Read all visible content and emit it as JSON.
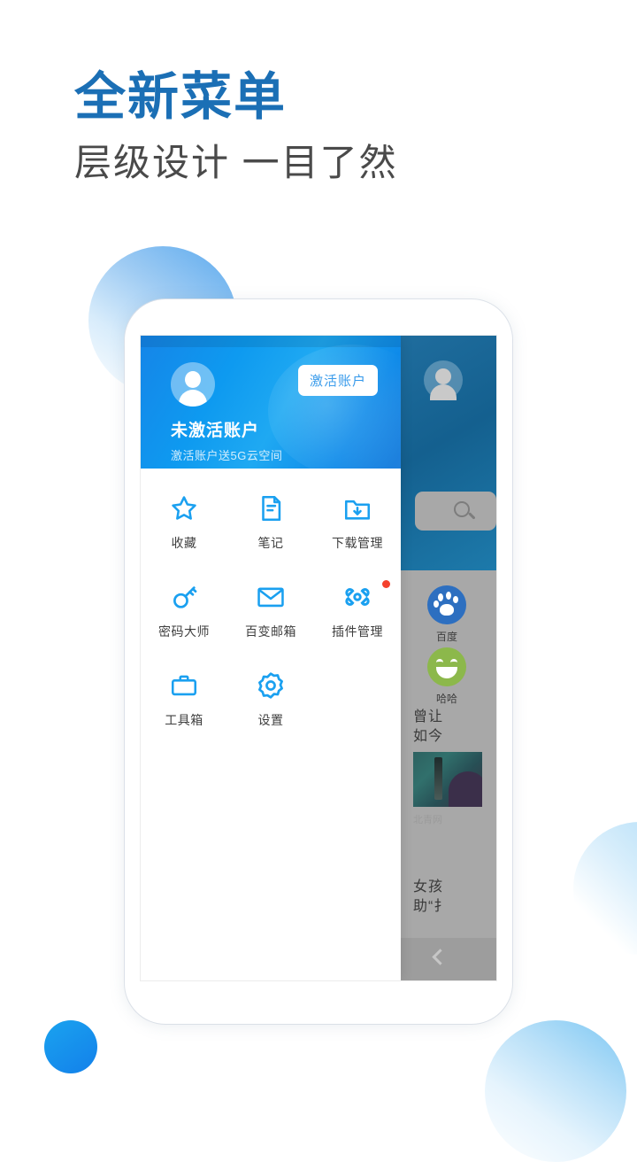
{
  "promo": {
    "headline": "全新菜单",
    "subheadline": "层级设计 一目了然",
    "headline_color": "#1b6fb5",
    "subheadline_color": "#4a4a4a"
  },
  "phone": {
    "menu_panel": {
      "header": {
        "avatar_icon": "user-avatar-icon",
        "activate_button": "激活账户",
        "title": "未激活账户",
        "subtitle": "激活账户送5G云空间",
        "gradient_from": "#1585e8",
        "gradient_to": "#1f7fdc"
      },
      "grid": [
        {
          "label": "收藏",
          "icon": "star-icon",
          "badge": false
        },
        {
          "label": "笔记",
          "icon": "note-icon",
          "badge": false
        },
        {
          "label": "下载管理",
          "icon": "download-folder-icon",
          "badge": false
        },
        {
          "label": "密码大师",
          "icon": "key-icon",
          "badge": false
        },
        {
          "label": "百变邮箱",
          "icon": "envelope-icon",
          "badge": false
        },
        {
          "label": "插件管理",
          "icon": "plugin-icon",
          "badge": true
        },
        {
          "label": "工具箱",
          "icon": "toolbox-icon",
          "badge": false
        },
        {
          "label": "设置",
          "icon": "gear-icon",
          "badge": false
        }
      ],
      "icon_color": "#1aa0f0"
    },
    "background_panel": {
      "avatar_icon": "user-avatar-icon",
      "search_icon": "search-icon",
      "shortcuts": [
        {
          "label": "百度",
          "icon": "baidu-paw-icon",
          "color": "#2d6fc0"
        },
        {
          "label": "哈哈",
          "icon": "smiley-icon",
          "color": "#8cb84b"
        }
      ],
      "news": [
        {
          "line1": "曾让",
          "line2": "如今",
          "source": "北青网",
          "has_thumbnail": true
        },
        {
          "line1": "女孩",
          "line2": "助“扌",
          "source": "",
          "has_thumbnail": false
        }
      ],
      "back_icon": "chevron-left-icon",
      "overlay_color": "#a8a8a8"
    }
  },
  "decorations": {
    "circle_top_left": "#5aa9ee",
    "circle_right": "#a9daf7",
    "circle_bottom_right": "#7cc7f3",
    "circle_bottom_left": "#1aa3ef"
  }
}
